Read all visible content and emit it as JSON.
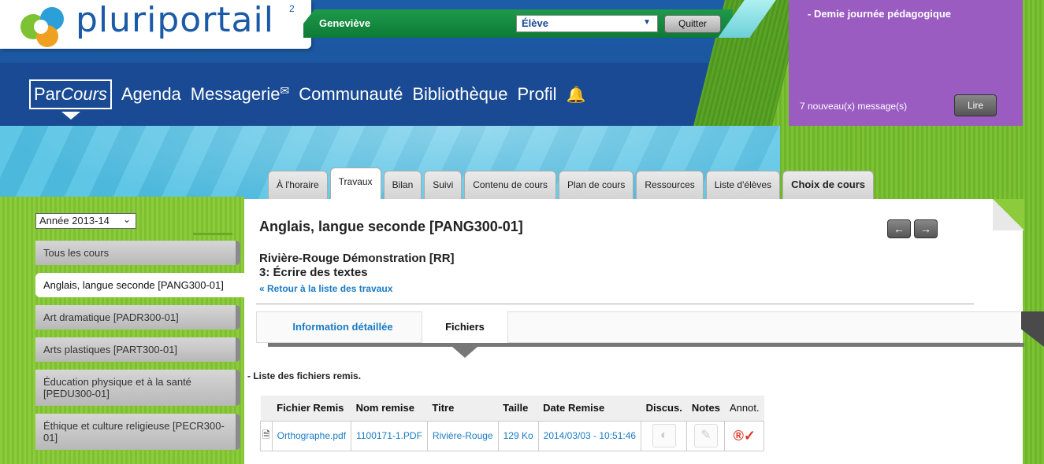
{
  "header": {
    "logo_text": "pluriportail",
    "logo_sup": "2",
    "user_name": "Geneviève",
    "role": "Élève",
    "quit_label": "Quitter"
  },
  "nav": {
    "parcours_prefix": "Par",
    "parcours_suffix": "Cours",
    "agenda": "Agenda",
    "messagerie": "Messagerie",
    "communaute": "Communauté",
    "bibliotheque": "Bibliothèque",
    "profil": "Profil"
  },
  "news": {
    "title": "- Demie journée pédagogique",
    "count": "7 nouveau(x) message(s)",
    "read_label": "Lire"
  },
  "tabs": [
    {
      "label": "À l'horaire"
    },
    {
      "label": "Travaux"
    },
    {
      "label": "Bilan"
    },
    {
      "label": "Suivi"
    },
    {
      "label": "Contenu de cours"
    },
    {
      "label": "Plan de cours"
    },
    {
      "label": "Ressources"
    },
    {
      "label": "Liste d'élèves"
    },
    {
      "label": "Choix de cours"
    }
  ],
  "sidebar": {
    "year": "Année 2013-14",
    "courses": [
      {
        "label": "Tous les cours"
      },
      {
        "label": "Anglais, langue seconde [PANG300-01]"
      },
      {
        "label": "Art dramatique [PADR300-01]"
      },
      {
        "label": "Arts plastiques [PART300-01]"
      },
      {
        "label": "Éducation physique et à la santé [PEDU300-01]"
      },
      {
        "label": "Éthique et culture religieuse [PECR300-01]"
      }
    ]
  },
  "main": {
    "course_title": "Anglais, langue seconde [PANG300-01]",
    "prev_icon": "←",
    "next_icon": "→",
    "school": "Rivière-Rouge Démonstration [RR]",
    "work_title": "3: Écrire des textes",
    "back_link": "« Retour à la liste des travaux",
    "subtab_info": "Information détaillée",
    "subtab_files": "Fichiers",
    "list_caption": "- Liste des fichiers remis."
  },
  "table": {
    "headers": [
      "Fichier Remis",
      "Nom remise",
      "Titre",
      "Taille",
      "Date Remise",
      "Discus.",
      "Notes",
      "Annot."
    ],
    "rows": [
      {
        "file": "Orthographe.pdf",
        "name": "1100171-1.PDF",
        "title": "Rivière-Rouge",
        "size": "129 Ko",
        "date": "2014/03/03 - 10:51:46"
      }
    ]
  },
  "colors": {
    "header_blue": "#1a4a93",
    "green": "#7cc233",
    "purple": "#9b5cc2",
    "link_blue": "#1a7bc4"
  }
}
